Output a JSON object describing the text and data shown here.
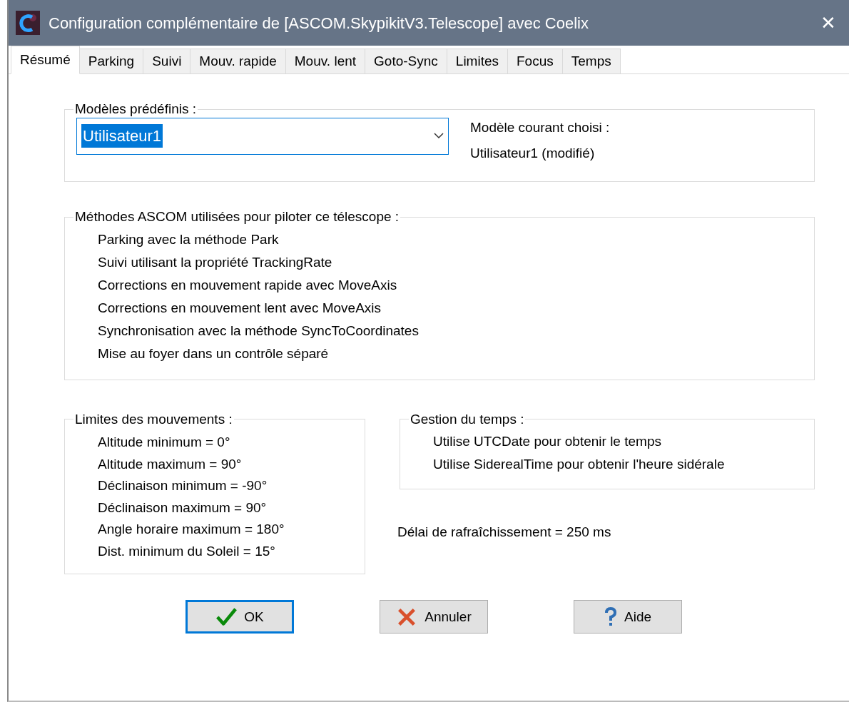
{
  "window": {
    "title": "Configuration complémentaire de [ASCOM.SkypikitV3.Telescope] avec Coelix",
    "close": "✕"
  },
  "tabs": [
    {
      "label": "Résumé",
      "selected": true
    },
    {
      "label": "Parking",
      "selected": false
    },
    {
      "label": "Suivi",
      "selected": false
    },
    {
      "label": "Mouv. rapide",
      "selected": false
    },
    {
      "label": "Mouv. lent",
      "selected": false
    },
    {
      "label": "Goto-Sync",
      "selected": false
    },
    {
      "label": "Limites",
      "selected": false
    },
    {
      "label": "Focus",
      "selected": false
    },
    {
      "label": "Temps",
      "selected": false
    }
  ],
  "models": {
    "title": "Modèles prédéfinis :",
    "combo": {
      "value": "Utilisateur1",
      "highlighted": true
    },
    "current_label": "Modèle courant choisi :",
    "current_value": "Utilisateur1 (modifié)"
  },
  "methods": {
    "title": "Méthodes ASCOM utilisées pour piloter ce télescope :",
    "items": [
      "Parking avec la méthode Park",
      "Suivi utilisant la propriété TrackingRate",
      "Corrections en mouvement rapide avec MoveAxis",
      "Corrections en mouvement lent avec MoveAxis",
      "Synchronisation avec la méthode SyncToCoordinates",
      "Mise au foyer dans un contrôle séparé"
    ]
  },
  "limits": {
    "title": "Limites des mouvements :",
    "items": [
      "Altitude minimum = 0°",
      "Altitude maximum = 90°",
      "Déclinaison minimum = -90°",
      "Déclinaison maximum = 90°",
      "Angle horaire maximum = 180°",
      "Dist. minimum du Soleil = 15°"
    ]
  },
  "time": {
    "title": "Gestion du temps :",
    "items": [
      "Utilise UTCDate pour obtenir le temps",
      "Utilise SiderealTime pour obtenir l'heure sidérale"
    ]
  },
  "refresh": "Délai de rafraîchissement = 250 ms",
  "buttons": [
    {
      "kind": "ok",
      "label": "OK",
      "default": true
    },
    {
      "kind": "cancel",
      "label": "Annuler",
      "default": false
    },
    {
      "kind": "help",
      "label": "Aide",
      "default": false
    }
  ]
}
